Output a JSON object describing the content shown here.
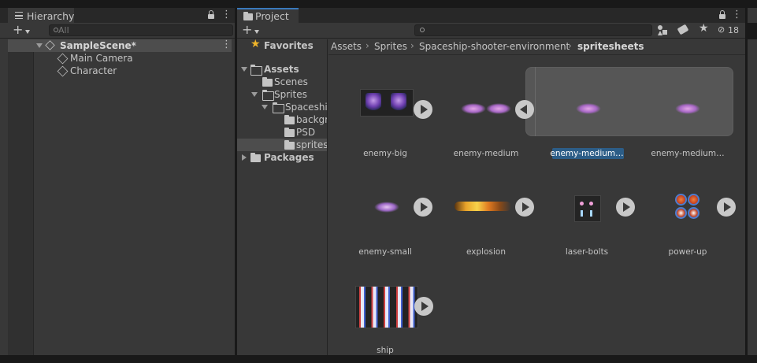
{
  "hierarchy": {
    "tab_label": "Hierarchy",
    "search_placeholder": "All",
    "scene_name": "SampleScene*",
    "objects": [
      "Main Camera",
      "Character"
    ]
  },
  "project": {
    "tab_label": "Project",
    "search_value": "",
    "hidden_count": "18",
    "favorites_label": "Favorites",
    "tree": {
      "assets": "Assets",
      "scenes": "Scenes",
      "sprites": "Sprites",
      "spaceship": "Spaceshi",
      "backgrounds": "backgr",
      "psd": "PSD",
      "spritesheets": "sprites",
      "packages": "Packages"
    },
    "breadcrumb": [
      "Assets",
      "Sprites",
      "Spaceship-shooter-environment",
      "spritesheets"
    ],
    "assets": [
      {
        "name": "enemy-big"
      },
      {
        "name": "enemy-medium"
      },
      {
        "name": "enemy-medium…",
        "selected": true
      },
      {
        "name": "enemy-medium…"
      },
      {
        "name": "enemy-small"
      },
      {
        "name": "explosion"
      },
      {
        "name": "laser-bolts"
      },
      {
        "name": "power-up"
      },
      {
        "name": "ship"
      }
    ]
  },
  "colors": {
    "selection": "#2c5d87",
    "panel": "#383838",
    "header": "#282828"
  }
}
